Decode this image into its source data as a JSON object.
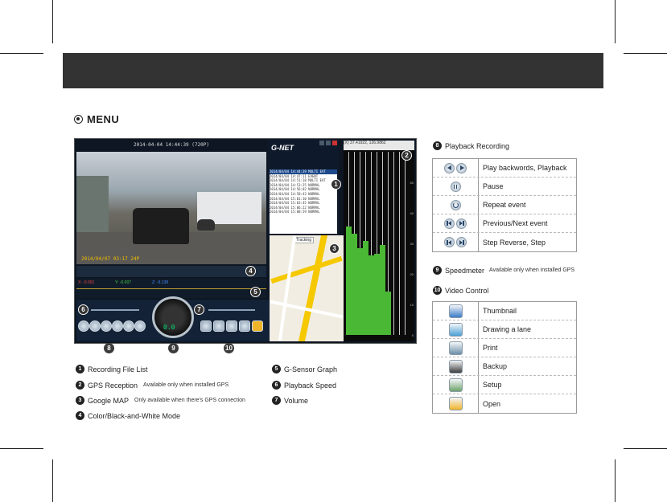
{
  "heading": "MENU",
  "screenshot": {
    "video_header": "2014-04-04 14:44:39 (720P)",
    "video_stamp": "2014/04/07 03:17 24P",
    "gsensor": {
      "x": "X: -0.001",
      "y": "Y: -0.007",
      "z": "Z: -0.138"
    },
    "speed_readout": "0.0",
    "app_logo": "G-NET",
    "file_list": [
      "2014/04/04 14:44:39   MULTI EVT",
      "2014/04/04 14:47:11   EVENT",
      "2014/04/04 14:51:18   MULTI EVT",
      "2014/04/04 14:53:25   NORMAL",
      "2014/04/04 14:56:02   NORMAL",
      "2014/04/04 14:58:43   NORMAL",
      "2014/04/04 15:01:10   NORMAL",
      "2014/04/04 15:03:45   NORMAL",
      "2014/04/04 15:06:22   NORMAL",
      "2014/04/04 15:08:59   NORMAL"
    ],
    "map_tracking": "Tracking",
    "graph_header": "(X) 37.41922, 126.9862",
    "graph_y_ticks": [
      "50",
      "40",
      "30",
      "20",
      "10",
      "0"
    ],
    "badges": [
      "1",
      "2",
      "3",
      "4",
      "5",
      "6",
      "7",
      "8",
      "9",
      "10"
    ]
  },
  "legend_left": [
    {
      "num": "1",
      "label": "Recording File List",
      "note": ""
    },
    {
      "num": "2",
      "label": "GPS Reception",
      "note": "Available only when installed GPS"
    },
    {
      "num": "3",
      "label": "Google MAP",
      "note": "Only available when there's GPS connection"
    },
    {
      "num": "4",
      "label": "Color/Black-and-White Mode",
      "note": ""
    }
  ],
  "legend_mid": [
    {
      "num": "5",
      "label": "G-Sensor Graph"
    },
    {
      "num": "6",
      "label": "Playback Speed"
    },
    {
      "num": "7",
      "label": "Volume"
    }
  ],
  "playback": {
    "num": "8",
    "title": "Playback Recording",
    "rows": [
      {
        "icons": [
          "play-backward-icon",
          "play-forward-icon"
        ],
        "label": "Play backwords, Playback"
      },
      {
        "icons": [
          "pause-icon"
        ],
        "label": "Pause"
      },
      {
        "icons": [
          "repeat-icon"
        ],
        "label": "Repeat event"
      },
      {
        "icons": [
          "previous-event-icon",
          "next-event-icon"
        ],
        "label": "Previous/Next event"
      },
      {
        "icons": [
          "step-reverse-icon",
          "step-forward-icon"
        ],
        "label": "Step Reverse, Step"
      }
    ]
  },
  "speedmeter": {
    "num": "9",
    "title": "Speedmeter",
    "note": "Available only when installed GPS"
  },
  "video_control": {
    "num": "10",
    "title": "Video Control",
    "rows": [
      {
        "icon": "thumbnail-icon",
        "label": "Thumbnail",
        "color": "#3a7bc8"
      },
      {
        "icon": "drawing-lane-icon",
        "label": "Drawing a lane",
        "color": "#4aa0d6"
      },
      {
        "icon": "print-icon",
        "label": "Print",
        "color": "#6c8fa8"
      },
      {
        "icon": "backup-icon",
        "label": "Backup",
        "color": "#3d3d3d"
      },
      {
        "icon": "setup-icon",
        "label": "Setup",
        "color": "#6ea36a"
      },
      {
        "icon": "open-folder-icon",
        "label": "Open",
        "color": "#f0b429"
      }
    ]
  }
}
